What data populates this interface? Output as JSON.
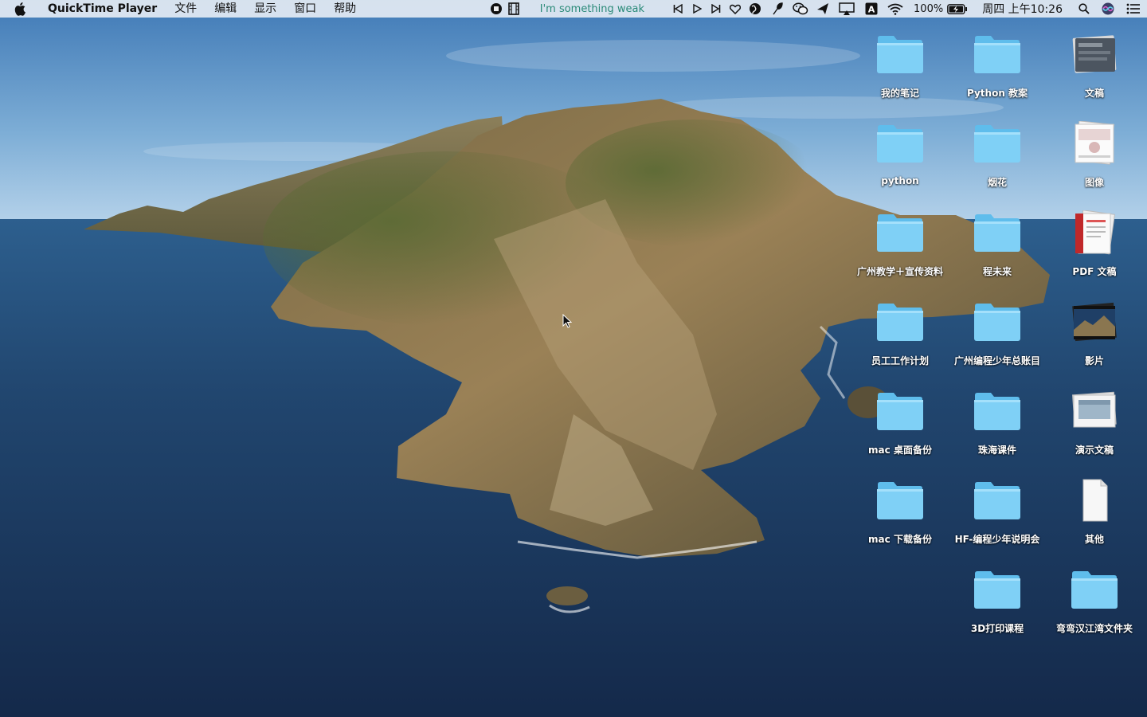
{
  "menubar": {
    "app_name": "QuickTime Player",
    "menus": [
      "文件",
      "编辑",
      "显示",
      "窗口",
      "帮助"
    ],
    "now_playing": "I'm something weak",
    "battery": "100%",
    "clock": "周四 上午10:26",
    "status_icons": [
      "stop-recording-icon",
      "film-icon",
      "previous-track-icon",
      "play-icon",
      "next-track-icon",
      "heart-icon",
      "globe-icon",
      "feather-icon",
      "wechat-icon",
      "send-icon",
      "airplay-icon",
      "input-source-icon",
      "wifi-icon",
      "battery-icon",
      "spotlight-search-icon",
      "siri-icon",
      "notification-center-icon"
    ]
  },
  "desktop": {
    "icons": [
      {
        "label": "我的笔记",
        "type": "folder"
      },
      {
        "label": "Python 教案",
        "type": "folder"
      },
      {
        "label": "文稿",
        "type": "stack-docs"
      },
      {
        "label": "python",
        "type": "folder"
      },
      {
        "label": "烟花",
        "type": "folder"
      },
      {
        "label": "图像",
        "type": "stack-images"
      },
      {
        "label": "广州教学＋宣传资料",
        "type": "folder"
      },
      {
        "label": "程未来",
        "type": "folder"
      },
      {
        "label": "PDF 文稿",
        "type": "stack-pdf"
      },
      {
        "label": "员工工作计划",
        "type": "folder"
      },
      {
        "label": "广州编程少年总账目",
        "type": "folder"
      },
      {
        "label": "影片",
        "type": "stack-movies"
      },
      {
        "label": "mac 桌面备份",
        "type": "folder"
      },
      {
        "label": "珠海课件",
        "type": "folder"
      },
      {
        "label": "演示文稿",
        "type": "stack-presentations"
      },
      {
        "label": "mac 下载备份",
        "type": "folder"
      },
      {
        "label": "HF-编程少年说明会",
        "type": "folder"
      },
      {
        "label": "其他",
        "type": "stack-other"
      },
      {
        "label": "3D打印课程",
        "type": "folder"
      },
      {
        "label": "弯弯汉江湾文件夹",
        "type": "folder"
      }
    ]
  },
  "colors": {
    "folder_front": "#7fd0f6",
    "folder_back": "#5fbdec",
    "sky": "#5d93c6",
    "ocean": "#1c3a5e"
  }
}
